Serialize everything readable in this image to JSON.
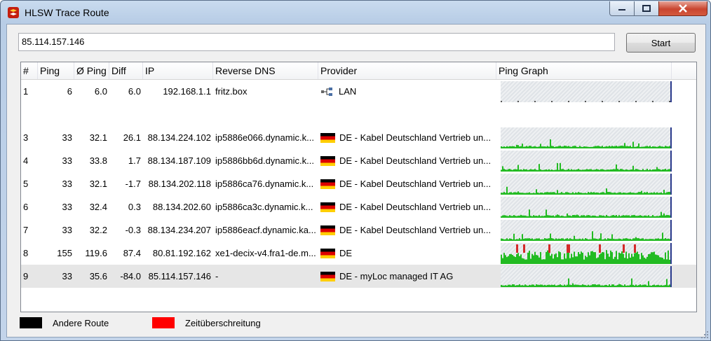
{
  "window": {
    "title": "HLSW Trace Route"
  },
  "toolbar": {
    "address": "85.114.157.146",
    "start_label": "Start"
  },
  "columns": [
    "#",
    "Ping",
    "Ø Ping",
    "Diff",
    "IP",
    "Reverse DNS",
    "Provider",
    "Ping Graph"
  ],
  "rows": [
    {
      "num": "1",
      "ping": "6",
      "avg": "6.0",
      "diff": "6.0",
      "ip": "192.168.1.1",
      "dns": "fritz.box",
      "provider": "LAN",
      "icon": "lan-icon"
    },
    {
      "num": "3",
      "ping": "33",
      "avg": "32.1",
      "diff": "26.1",
      "ip": "88.134.224.102",
      "dns": "ip5886e066.dynamic.k...",
      "provider": "DE - Kabel Deutschland Vertrieb un...",
      "icon": "flag-de-icon"
    },
    {
      "num": "4",
      "ping": "33",
      "avg": "33.8",
      "diff": "1.7",
      "ip": "88.134.187.109",
      "dns": "ip5886bb6d.dynamic.k...",
      "provider": "DE - Kabel Deutschland Vertrieb un...",
      "icon": "flag-de-icon"
    },
    {
      "num": "5",
      "ping": "33",
      "avg": "32.1",
      "diff": "-1.7",
      "ip": "88.134.202.118",
      "dns": "ip5886ca76.dynamic.k...",
      "provider": "DE - Kabel Deutschland Vertrieb un...",
      "icon": "flag-de-icon"
    },
    {
      "num": "6",
      "ping": "33",
      "avg": "32.4",
      "diff": "0.3",
      "ip": "88.134.202.60",
      "dns": "ip5886ca3c.dynamic.k...",
      "provider": "DE - Kabel Deutschland Vertrieb un...",
      "icon": "flag-de-icon"
    },
    {
      "num": "7",
      "ping": "33",
      "avg": "32.2",
      "diff": "-0.3",
      "ip": "88.134.234.207",
      "dns": "ip5886eacf.dynamic.ka...",
      "provider": "DE - Kabel Deutschland Vertrieb un...",
      "icon": "flag-de-icon"
    },
    {
      "num": "8",
      "ping": "155",
      "avg": "119.6",
      "diff": "87.4",
      "ip": "80.81.192.162",
      "dns": "xe1-decix-v4.fra1-de.m...",
      "provider": "DE",
      "icon": "flag-de-icon"
    },
    {
      "num": "9",
      "ping": "33",
      "avg": "35.6",
      "diff": "-84.0",
      "ip": "85.114.157.146",
      "dns": "-",
      "provider": "DE - myLoc managed IT AG",
      "icon": "flag-de-icon",
      "selected": true
    }
  ],
  "legend": {
    "other_route": "Andere Route",
    "timeout": "Zeitüberschreitung"
  },
  "colors": {
    "graph_ok": "#22bb22",
    "graph_timeout": "#d42a2a",
    "other_route": "#000000",
    "timeout": "#ff0000"
  }
}
